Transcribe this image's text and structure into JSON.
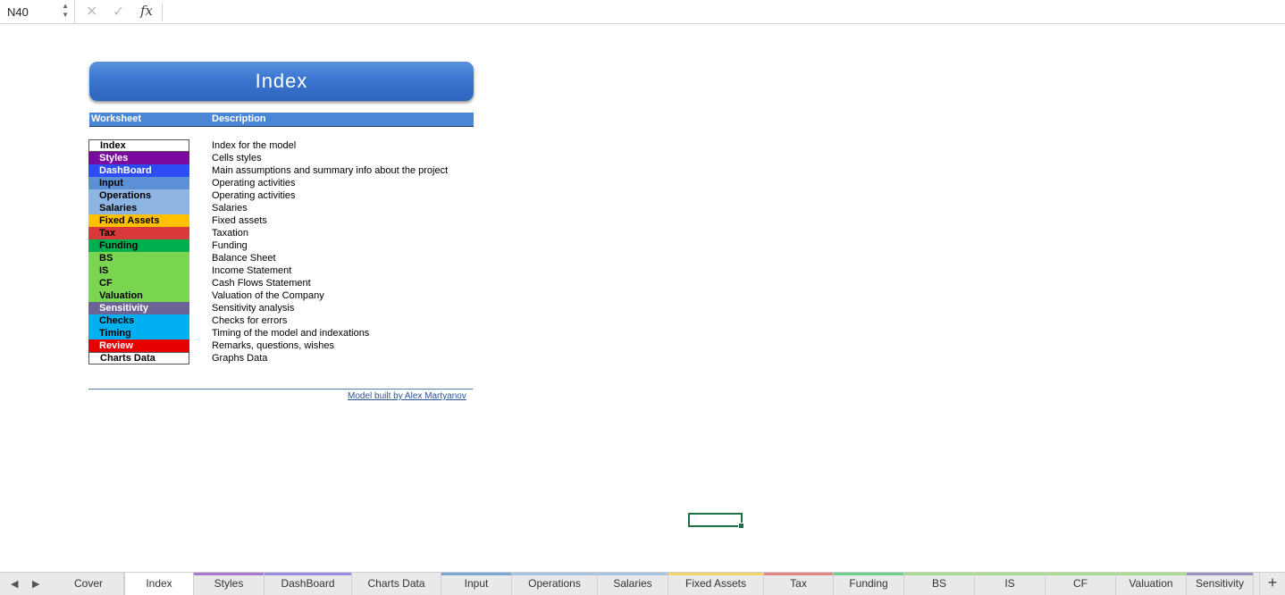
{
  "formula_bar": {
    "cell_ref": "N40",
    "cancel_glyph": "✕",
    "confirm_glyph": "✓",
    "fx_label": "fx",
    "formula": ""
  },
  "sheet": {
    "banner_title": "Index",
    "header": {
      "worksheet": "Worksheet",
      "description": "Description"
    },
    "rows": [
      {
        "name": "Index",
        "desc": "Index for the model",
        "bg": "#ffffff",
        "fg": "#000000",
        "border": true
      },
      {
        "name": "Styles",
        "desc": "Cells styles",
        "bg": "#7a0aa0",
        "fg": "#ffffff"
      },
      {
        "name": "DashBoard",
        "desc": "Main assumptions and summary info about the project",
        "bg": "#2d4cf4",
        "fg": "#ffffff"
      },
      {
        "name": "Input",
        "desc": "Operating activities",
        "bg": "#5b8fd6",
        "fg": "#000000"
      },
      {
        "name": "Operations",
        "desc": "Operating activities",
        "bg": "#8db4e2",
        "fg": "#000000"
      },
      {
        "name": "Salaries",
        "desc": "Salaries",
        "bg": "#8db4e2",
        "fg": "#000000"
      },
      {
        "name": "Fixed Assets",
        "desc": "Fixed assets",
        "bg": "#ffc000",
        "fg": "#000000"
      },
      {
        "name": "Tax",
        "desc": "Taxation",
        "bg": "#d9393a",
        "fg": "#000000"
      },
      {
        "name": "Funding",
        "desc": "Funding",
        "bg": "#00b050",
        "fg": "#000000"
      },
      {
        "name": "BS",
        "desc": "Balance Sheet",
        "bg": "#7ad650",
        "fg": "#000000"
      },
      {
        "name": "IS",
        "desc": "Income Statement",
        "bg": "#7ad650",
        "fg": "#000000"
      },
      {
        "name": "CF",
        "desc": "Cash Flows Statement",
        "bg": "#7ad650",
        "fg": "#000000"
      },
      {
        "name": "Valuation",
        "desc": "Valuation of the Company",
        "bg": "#7ad650",
        "fg": "#000000"
      },
      {
        "name": "Sensitivity",
        "desc": "Sensitivity analysis",
        "bg": "#6b6296",
        "fg": "#ffffff"
      },
      {
        "name": "Checks",
        "desc": "Checks for errors",
        "bg": "#00b0f0",
        "fg": "#000000"
      },
      {
        "name": "Timing",
        "desc": "Timing of the model and indexations",
        "bg": "#00b0f0",
        "fg": "#000000"
      },
      {
        "name": "Review",
        "desc": "Remarks, questions, wishes",
        "bg": "#e60000",
        "fg": "#ffffff"
      },
      {
        "name": "Charts Data",
        "desc": "Graphs Data",
        "bg": "#ffffff",
        "fg": "#000000",
        "border": true
      }
    ],
    "footer_link": "Model built by Alex Martyanov"
  },
  "tabs": {
    "prev_glyph": "◀",
    "next_glyph": "▶",
    "add_glyph": "+",
    "active": "Index",
    "items": [
      {
        "label": "Cover",
        "stripe": ""
      },
      {
        "label": "Index",
        "stripe": ""
      },
      {
        "label": "Styles",
        "stripe": "#a77bd0"
      },
      {
        "label": "DashBoard",
        "stripe": "#9a8fe0"
      },
      {
        "label": "Charts Data",
        "stripe": ""
      },
      {
        "label": "Input",
        "stripe": "#7aa6d8"
      },
      {
        "label": "Operations",
        "stripe": "#a9c4e6"
      },
      {
        "label": "Salaries",
        "stripe": "#a9c4e6"
      },
      {
        "label": "Fixed Assets",
        "stripe": "#f2d46a"
      },
      {
        "label": "Tax",
        "stripe": "#e48383"
      },
      {
        "label": "Funding",
        "stripe": "#6ccf8f"
      },
      {
        "label": "BS",
        "stripe": "#a6de8e"
      },
      {
        "label": "IS",
        "stripe": "#a6de8e"
      },
      {
        "label": "CF",
        "stripe": "#a6de8e"
      },
      {
        "label": "Valuation",
        "stripe": "#a6de8e"
      },
      {
        "label": "Sensitivity",
        "stripe": "#9b93bf"
      }
    ]
  }
}
